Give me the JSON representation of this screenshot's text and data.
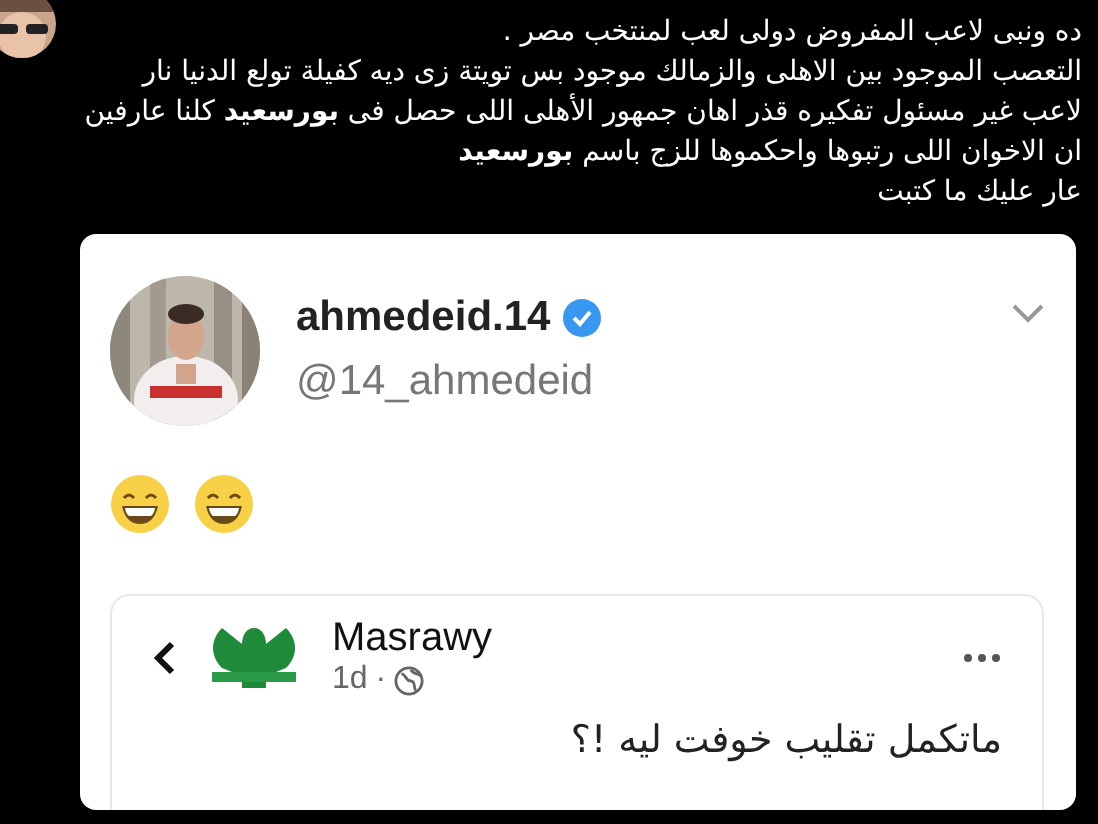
{
  "tweet": {
    "lines": [
      "ده ونبى  لاعب المفروض دولى لعب لمنتخب مصر .",
      "التعصب الموجود بين الاهلى والزمالك موجود بس تويتة زى ديه كفيلة تولع الدنيا نار",
      "لاعب غير مسئول تفكيره قذر اهان جمهور الأهلى اللى حصل فى **بورسعيد** كلنا عارفين",
      "ان الاخوان اللى رتبوها واحكموها للزج باسم **بورسعيد**",
      "عار عليك ما كتبت"
    ]
  },
  "embedded": {
    "name": "ahmedeid.14",
    "verified": true,
    "handle": "@14_ahmedeid",
    "emojis": [
      {
        "kind": "grin"
      },
      {
        "kind": "grin"
      }
    ],
    "quoted": {
      "name": "Masrawy",
      "time": "1d",
      "separator": "·",
      "text": "ماتكمل تقليب خوفت ليه !؟"
    }
  }
}
